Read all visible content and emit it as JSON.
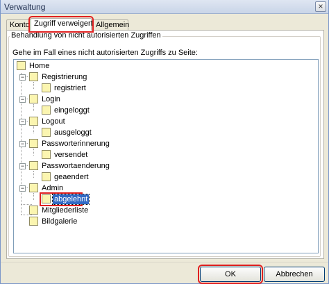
{
  "window": {
    "title": "Verwaltung",
    "close_glyph": "×"
  },
  "tabs": [
    {
      "label": "Konto"
    },
    {
      "label": "Zugriff verweigert"
    },
    {
      "label": "Allgemein"
    }
  ],
  "group": {
    "title": "Behandlung von nicht autorisierten Zugriffen",
    "prompt": "Gehe im Fall eines nicht autorisierten Zugriffs zu Seite:"
  },
  "tree": {
    "root": "Home",
    "items": [
      {
        "label": "Registrierung",
        "child": "registriert"
      },
      {
        "label": "Login",
        "child": "eingeloggt"
      },
      {
        "label": "Logout",
        "child": "ausgeloggt"
      },
      {
        "label": "Passworterinnerung",
        "child": "versendet"
      },
      {
        "label": "Passwortaenderung",
        "child": "geaendert"
      },
      {
        "label": "Admin",
        "child": "abgelehnt"
      },
      {
        "label": "Mitgliederliste"
      },
      {
        "label": "Bildgalerie"
      }
    ],
    "expander_glyph": "−",
    "selected": "abgelehnt"
  },
  "buttons": {
    "ok": "OK",
    "cancel": "Abbrechen"
  },
  "colors": {
    "selection": "#316ac5",
    "highlight": "#e02020",
    "folder": "#fbf5b0"
  }
}
